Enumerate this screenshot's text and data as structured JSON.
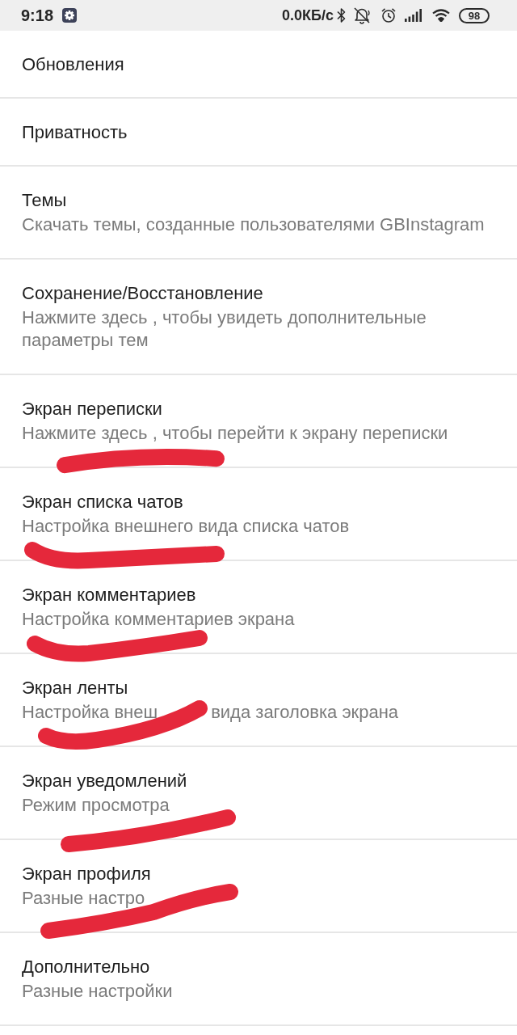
{
  "status_bar": {
    "time": "9:18",
    "network_speed": "0.0КБ/с",
    "battery": "98"
  },
  "items": [
    {
      "title": "Обновления",
      "scribbled": false
    },
    {
      "title": "Приватность",
      "scribbled": false
    },
    {
      "title": "Темы",
      "subtitle": [
        "Скачать темы, созданные пользователями GBInstagram"
      ],
      "scribbled": false
    },
    {
      "title": "Сохранение/Восстановление",
      "subtitle": [
        "Нажмите здесь , чтобы увидеть дополнительные параметры тем"
      ],
      "scribbled": false
    },
    {
      "title": "Экран переписки",
      "subtitle": [
        "Нажмите здесь , чтобы перейти к экрану переписки"
      ],
      "scribbled": true
    },
    {
      "title": "Экран списка чатов",
      "subtitle": [
        "Настройка внешнего вида списка чатов"
      ],
      "scribbled": true
    },
    {
      "title": "Экран комментариев",
      "subtitle": [
        "Настройка комментариев экрана"
      ],
      "scribbled": true
    },
    {
      "title": "Экран ленты",
      "subtitle": [
        "Настройка внеш",
        "вида заголовка экрана"
      ],
      "scribbled": true
    },
    {
      "title": "Экран уведомлений",
      "subtitle": [
        "Режим просмотра"
      ],
      "scribbled": true
    },
    {
      "title": "Экран профиля",
      "subtitle": [
        "Разные настро"
      ],
      "scribbled": true
    },
    {
      "title": "Дополнительно",
      "subtitle": [
        "Разные настройки"
      ],
      "scribbled": false
    }
  ]
}
